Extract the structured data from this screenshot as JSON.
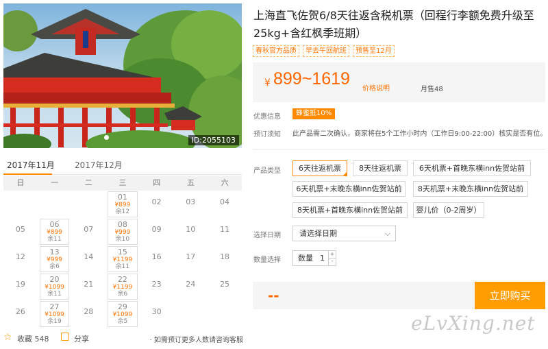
{
  "hero": {
    "id_text": "ID:2055103"
  },
  "calendar": {
    "tabs": [
      "2017年11月",
      "2017年12月"
    ],
    "weekdays": [
      "日",
      "一",
      "二",
      "三",
      "四",
      "五",
      "六"
    ],
    "rows": [
      [
        {
          "d": ""
        },
        {
          "d": ""
        },
        {
          "d": ""
        },
        {
          "d": "01",
          "p": "¥899",
          "s": "余12"
        },
        {
          "d": "02"
        },
        {
          "d": "03"
        },
        {
          "d": "04"
        }
      ],
      [
        {
          "d": "05"
        },
        {
          "d": "06",
          "p": "¥899",
          "s": "余11"
        },
        {
          "d": "07"
        },
        {
          "d": "08",
          "p": "¥999",
          "s": "余10"
        },
        {
          "d": "09"
        },
        {
          "d": "10"
        },
        {
          "d": "11"
        }
      ],
      [
        {
          "d": "12"
        },
        {
          "d": "13",
          "p": "¥999",
          "s": "余6"
        },
        {
          "d": "14"
        },
        {
          "d": "15",
          "p": "¥1199",
          "s": "余11"
        },
        {
          "d": "16"
        },
        {
          "d": "17"
        },
        {
          "d": "18"
        }
      ],
      [
        {
          "d": "19"
        },
        {
          "d": "20",
          "p": "¥1099",
          "s": "余11"
        },
        {
          "d": "21"
        },
        {
          "d": "22",
          "p": "¥1199",
          "s": "余6"
        },
        {
          "d": "23"
        },
        {
          "d": "24"
        },
        {
          "d": "25"
        }
      ],
      [
        {
          "d": "26"
        },
        {
          "d": "27",
          "p": "¥1099",
          "s": "余19"
        },
        {
          "d": "28"
        },
        {
          "d": "29",
          "p": "¥1099",
          "s": "余5"
        },
        {
          "d": "30"
        },
        {
          "d": ""
        },
        {
          "d": ""
        }
      ]
    ]
  },
  "bottom": {
    "favorite_label": "收藏 548",
    "share_label": "分享",
    "contact_text": "· 如需预订更多人数请咨询客服"
  },
  "product": {
    "title": "上海直飞佐贺6/8天往返含税机票（回程行李额免费升级至25kg+含红枫季班期）",
    "tags": [
      "春秋官方品质",
      "早去午回航班",
      "预售至12月"
    ],
    "price_currency": "¥",
    "price_range": "899~1619",
    "price_note": "价格说明",
    "monthly_sales": "月售48",
    "promo_label": "优惠信息",
    "promo_badge": "蜂蜜抵10%",
    "notice_label": "预订须知",
    "notice_text": "此产品需二次确认，商家将在5个工作小时内（工作日9:00-22:00）核实是否有位。",
    "type_label": "产品类型",
    "options": [
      "6天往返机票",
      "8天往返机票",
      "6天机票+首晚东横inn佐贺站前",
      "6天机票+末晚东横inn佐贺站前",
      "8天机票+末晚东横inn佐贺站前",
      "8天机票+首晚东横inn佐贺站前",
      "婴儿价（0-2周岁）"
    ],
    "date_label": "选择日期",
    "date_placeholder": "请选择日期",
    "qty_label": "数量选择",
    "qty_text": "数量",
    "qty_value": "1",
    "total": "--",
    "buy_label": "立即购买"
  },
  "watermark": "eLvXing.net",
  "colors": {
    "accent": "#ff8a00",
    "price": "#ff6600",
    "buy": "#ff9c00"
  }
}
